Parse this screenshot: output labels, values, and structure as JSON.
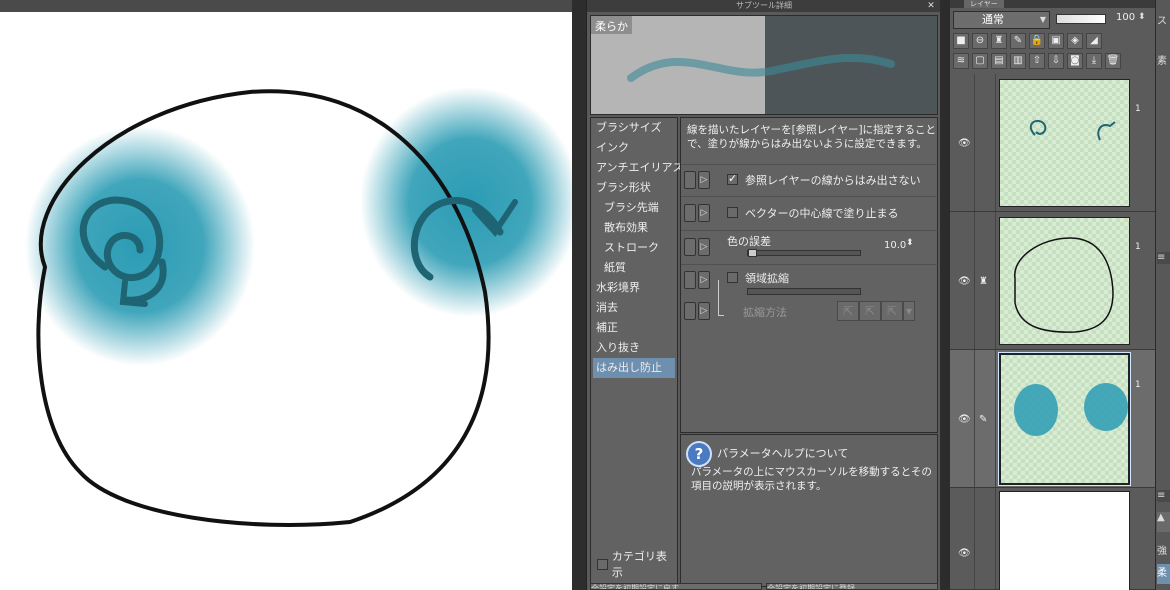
{
  "subtool_panel": {
    "title": "サブツール詳細",
    "preview_label": "柔らか",
    "categories": [
      "ブラシサイズ",
      "インク",
      "アンチエイリアス",
      "ブラシ形状",
      "ブラシ先端",
      "散布効果",
      "ストローク",
      "紙質",
      "水彩境界",
      "消去",
      "補正",
      "入り抜き",
      "はみ出し防止"
    ],
    "selected_category": "はみ出し防止",
    "category_toggle": "カテゴリ表示",
    "description": "線を描いたレイヤーを[参照レイヤー]に指定することで、塗りが線からはみ出ないように設定できます。",
    "settings": {
      "ref_layer_label": "参照レイヤーの線からはみ出さない",
      "vector_label": "ベクターの中心線で塗り止まる",
      "color_margin_label": "色の誤差",
      "color_margin_value": "10.0",
      "area_label": "領域拡縮",
      "area_method_label": "拡縮方法"
    },
    "help_title": "パラメータヘルプについて",
    "help_text": "パラメータの上にマウスカーソルを移動するとその項目の説明が表示されます。",
    "help_icon": "?",
    "bottom_buttons": [
      "全設定を初期設定に戻す",
      "全設定を初期設定に登録"
    ]
  },
  "layer_panel": {
    "tab": "レイヤー",
    "blend_mode": "通常",
    "opacity": "100",
    "layer_numbers": [
      "1",
      "1",
      "1"
    ]
  },
  "right_edge": {
    "items": [
      "ス",
      "素",
      "強",
      "柔"
    ]
  },
  "colors": {
    "teal": "#2b9cb4",
    "stroke": "#1e6472"
  }
}
